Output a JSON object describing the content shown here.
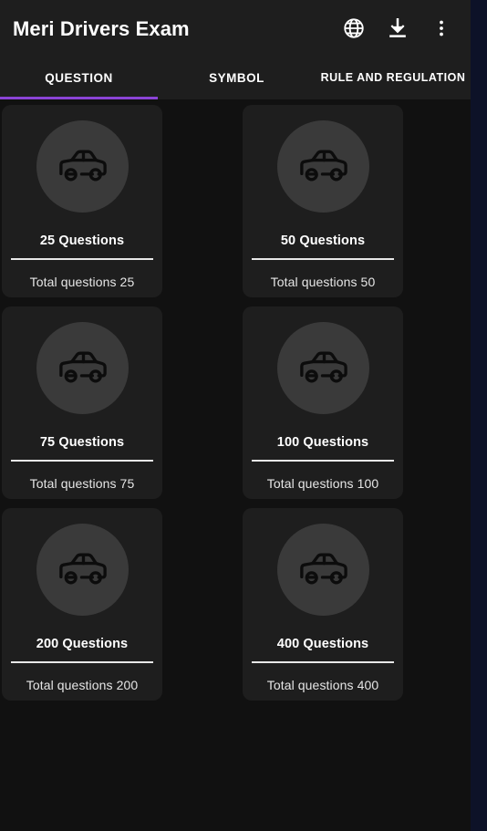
{
  "appbar": {
    "title": "Meri Drivers Exam",
    "actions": [
      {
        "name": "language-icon",
        "label": "Language"
      },
      {
        "name": "download-icon",
        "label": "Download"
      },
      {
        "name": "overflow-menu-icon",
        "label": "More options"
      }
    ]
  },
  "tabs": {
    "items": [
      {
        "label": "QUESTION",
        "selected": true
      },
      {
        "label": "SYMBOL",
        "selected": false
      },
      {
        "label": "RULE AND REGULATION",
        "selected": false
      }
    ],
    "indicator_color": "#8b44d6"
  },
  "theme": {
    "background": "#111111",
    "surface": "#1e1e1e",
    "accent": "#8b44d6",
    "circle": "#3a3a3a",
    "edge_strip": "#0d1228",
    "text_primary": "#ffffff"
  },
  "cards": [
    {
      "title": "25 Questions",
      "subtitle": "Total questions 25",
      "icon": "car-icon"
    },
    {
      "title": "50 Questions",
      "subtitle": "Total questions 50",
      "icon": "car-icon"
    },
    {
      "title": "75 Questions",
      "subtitle": "Total questions 75",
      "icon": "car-icon"
    },
    {
      "title": "100 Questions",
      "subtitle": "Total questions 100",
      "icon": "car-icon"
    },
    {
      "title": "200 Questions",
      "subtitle": "Total questions 200",
      "icon": "car-icon"
    },
    {
      "title": "400 Questions",
      "subtitle": "Total questions 400",
      "icon": "car-icon"
    }
  ]
}
